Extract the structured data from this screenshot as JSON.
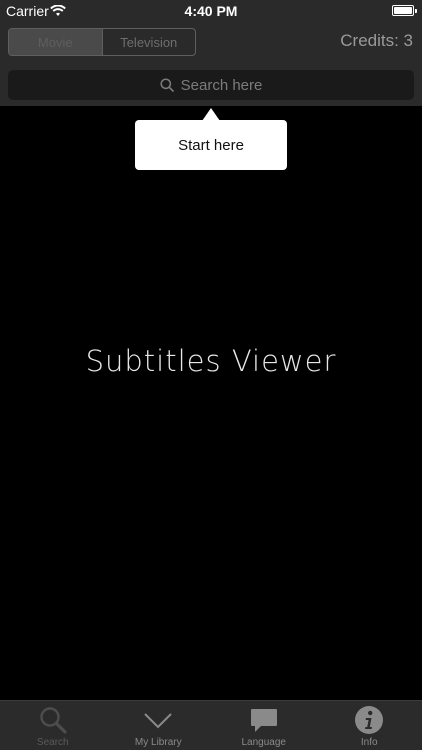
{
  "status_bar": {
    "carrier": "Carrier",
    "time": "4:40 PM"
  },
  "nav": {
    "segments": [
      {
        "label": "Movie",
        "selected": true
      },
      {
        "label": "Television",
        "selected": false
      }
    ],
    "credits": "Credits: 3"
  },
  "search": {
    "placeholder": "Search here",
    "icon": "search-icon"
  },
  "tooltip": {
    "text": "Start here"
  },
  "main": {
    "app_title": "Subtitles Viewer"
  },
  "tab_bar": {
    "tabs": [
      {
        "label": "Search",
        "icon": "search-icon",
        "active": true
      },
      {
        "label": "My Library",
        "icon": "chevron-down-icon",
        "active": false
      },
      {
        "label": "Language",
        "icon": "speech-bubble-icon",
        "active": false
      },
      {
        "label": "Info",
        "icon": "info-icon",
        "active": false
      }
    ]
  },
  "colors": {
    "bar_background": "#2a2a2a",
    "main_background": "#000000",
    "tooltip_background": "#ffffff"
  }
}
